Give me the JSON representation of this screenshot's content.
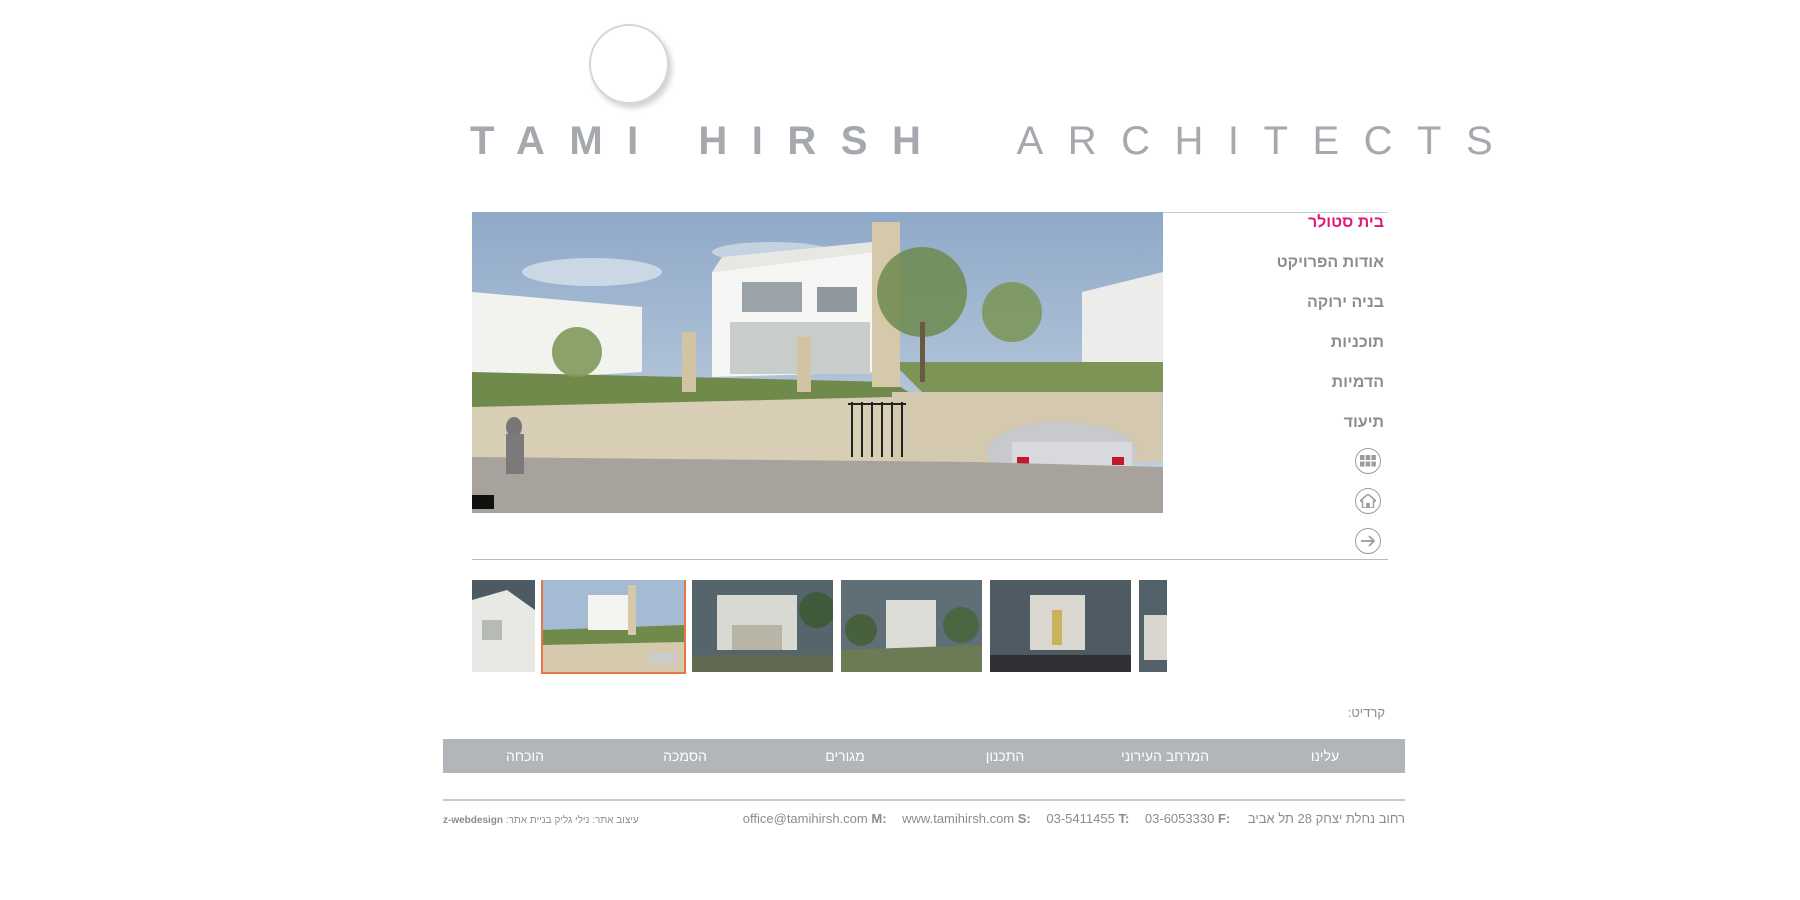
{
  "logo": {
    "name_bold": "TAMI HIRSH",
    "name_light": "ARCHITECTS",
    "icon": "circle-logo-mark"
  },
  "side_menu": {
    "items": [
      {
        "label": "בית סטולר",
        "active": true
      },
      {
        "label": "אודות הפרויקט",
        "active": false
      },
      {
        "label": "בניה ירוקה",
        "active": false
      },
      {
        "label": "תוכניות",
        "active": false
      },
      {
        "label": "הדמיות",
        "active": false
      },
      {
        "label": "תיעוד",
        "active": false
      }
    ],
    "icons": [
      "grid-icon",
      "home-icon",
      "arrow-right-icon"
    ],
    "active_color": "#e2167a"
  },
  "gallery": {
    "main_image": "architectural-rendering-house",
    "thumbnails": [
      {
        "subject": "house-side-partial"
      },
      {
        "subject": "house-front-selected"
      },
      {
        "subject": "house-courtyard"
      },
      {
        "subject": "house-garden-view"
      },
      {
        "subject": "house-facade-night"
      },
      {
        "subject": "house-partial"
      }
    ],
    "selected_border_color": "#e57744"
  },
  "credits": {
    "label": "קרדיט:"
  },
  "nav_bar": {
    "items": [
      "עלינו",
      "המרחב העירוני",
      "התכנון",
      "מגורים",
      "הסמכה",
      "הוכחה"
    ],
    "background": "#b2b6ba"
  },
  "footer": {
    "address": "רחוב נחלת יצחק 28 תל אביב",
    "fax_key": "F:",
    "fax": "03-6053330",
    "tel_key": "T:",
    "tel": "03-5411455",
    "site_key": "S:",
    "site": "www.tamihirsh.com",
    "mail_key": "M:",
    "mail": "office@tamihirsh.com",
    "design_text": "עיצוב אתר: נילי גליק  בניית אתר:",
    "design_brand": "z-webdesign"
  }
}
